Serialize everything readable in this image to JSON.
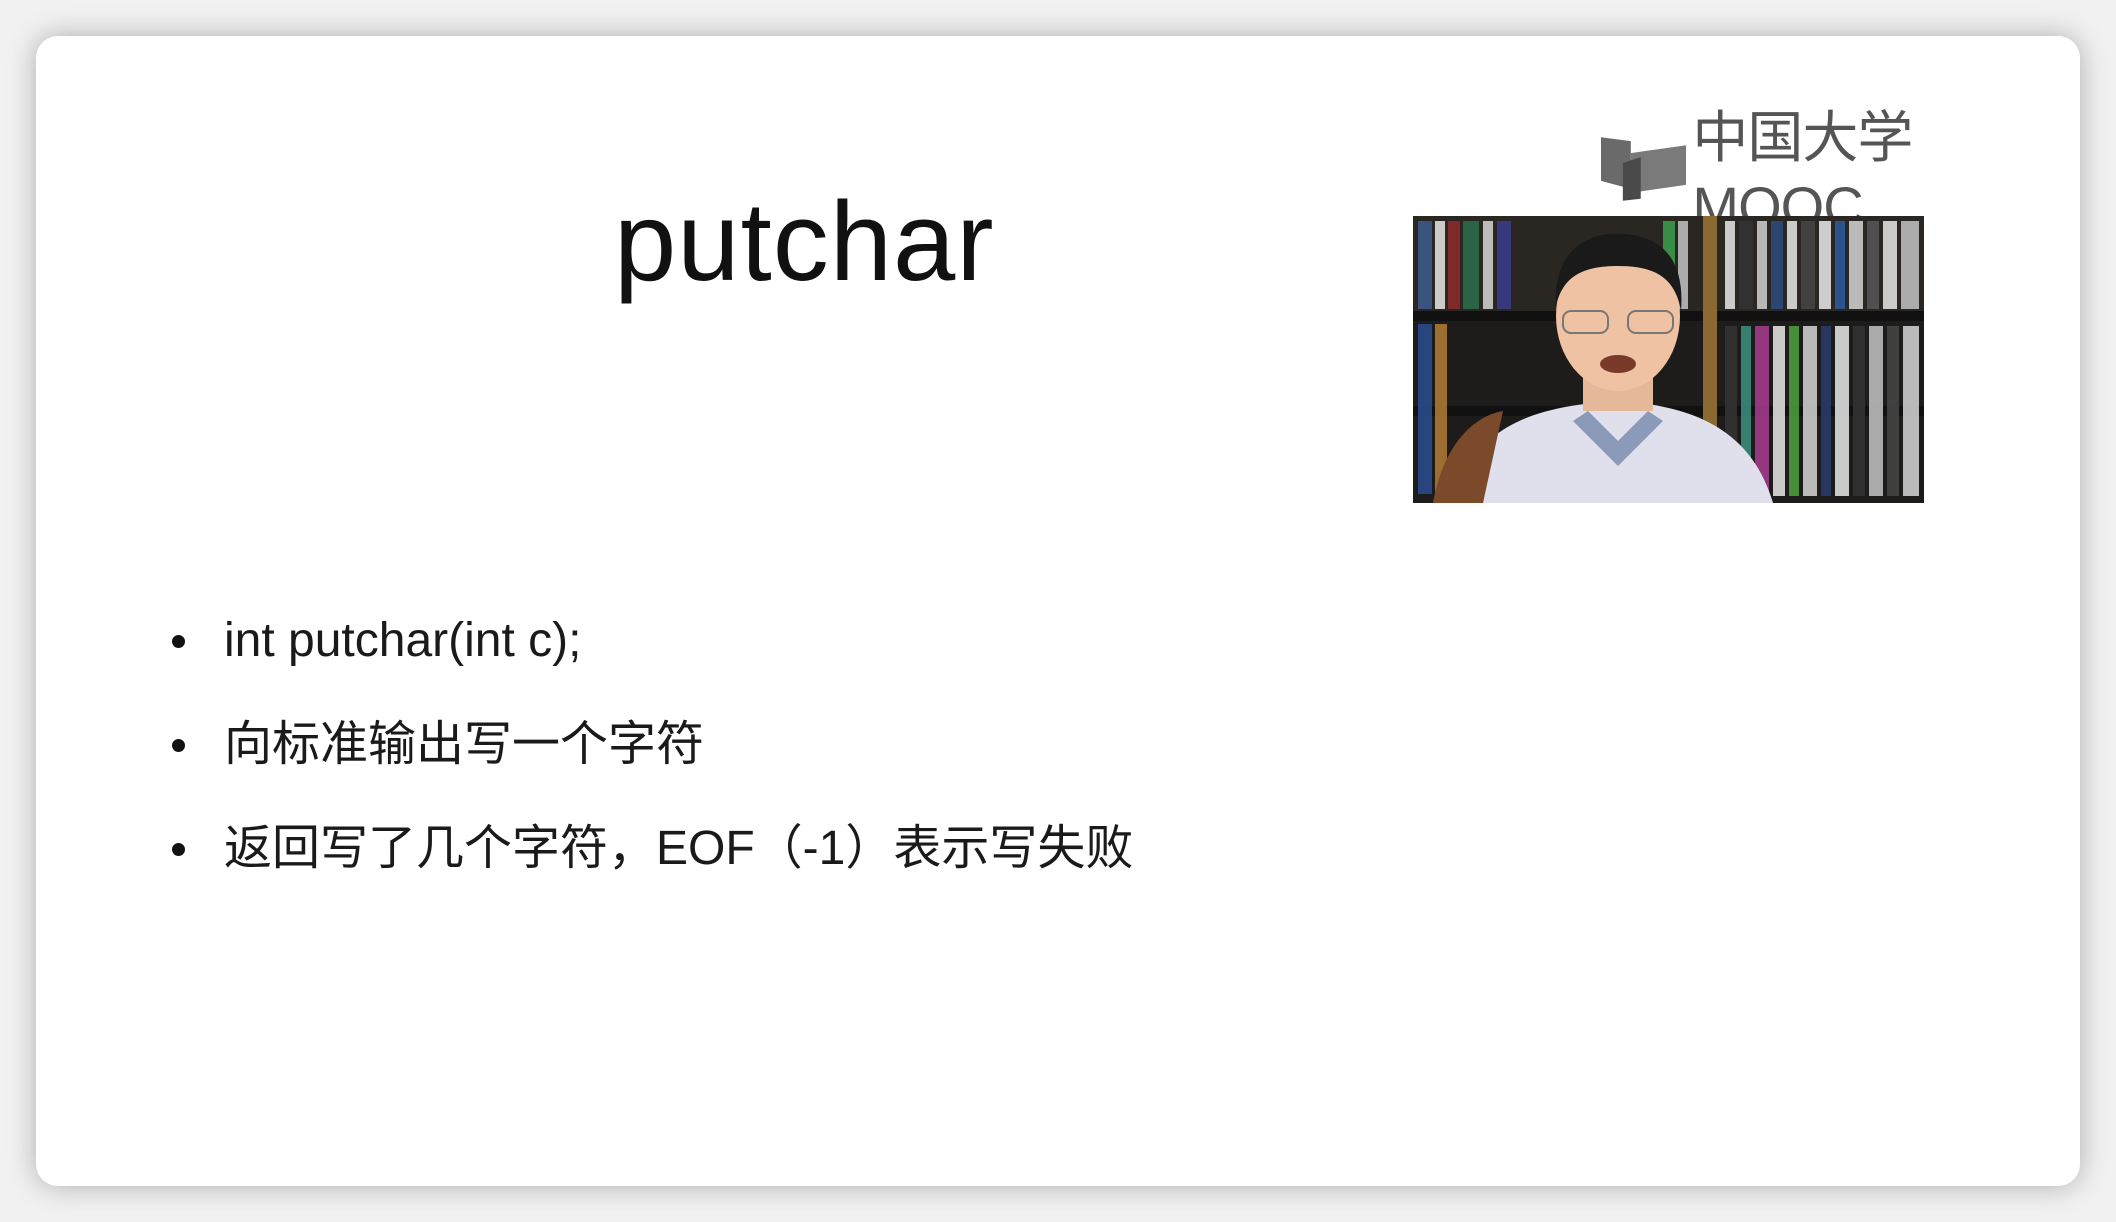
{
  "slide": {
    "title": "putchar",
    "bullets": [
      "int putchar(int c);",
      "向标准输出写一个字符",
      "返回写了几个字符，EOF（-1）表示写失败"
    ]
  },
  "logo": {
    "text": "中国大学MOOC",
    "icon": "open-book-icon"
  },
  "video": {
    "label": "instructor-video"
  },
  "colors": {
    "background": "#f1f1f1",
    "card": "#ffffff",
    "text": "#1a1a1a",
    "logo": "#555555"
  }
}
